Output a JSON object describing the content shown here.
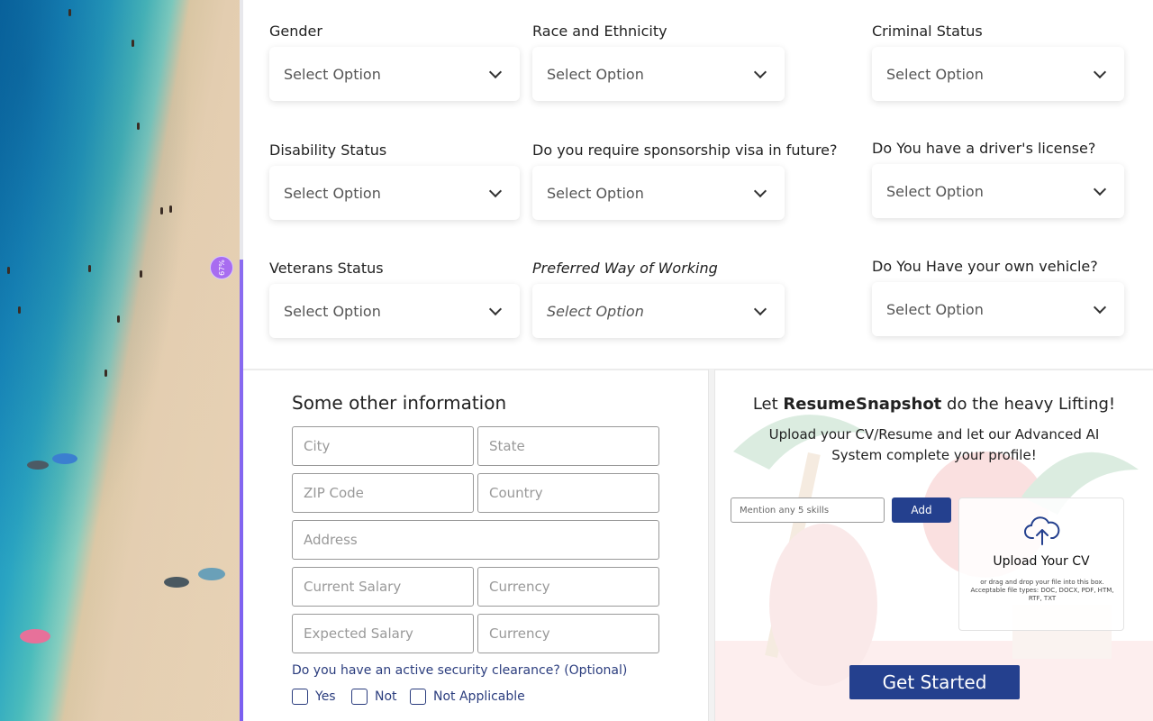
{
  "progress": {
    "percent_label": "67%",
    "value": 0.67
  },
  "select_placeholder": "Select Option",
  "fields": [
    {
      "label": "Gender",
      "value": "Select Option"
    },
    {
      "label": "Race and Ethnicity",
      "value": "Select Option"
    },
    {
      "label": "Criminal Status",
      "value": "Select Option"
    },
    {
      "label": "Disability Status",
      "value": "Select Option"
    },
    {
      "label": "Do you require sponsorship visa in future?",
      "value": "Select Option"
    },
    {
      "label": "Do You have a driver's license?",
      "value": "Select Option"
    },
    {
      "label": "Veterans Status",
      "value": "Select Option"
    },
    {
      "label": "Preferred Way of Working",
      "value": "Select Option"
    },
    {
      "label": "Do You Have your own vehicle?",
      "value": "Select Option"
    }
  ],
  "other_info": {
    "title": "Some other information",
    "placeholders": {
      "city": "City",
      "state": "State",
      "zip": "ZIP Code",
      "country": "Country",
      "address": "Address",
      "current_salary": "Current Salary",
      "current_currency": "Currency",
      "expected_salary": "Expected Salary",
      "expected_currency": "Currency"
    },
    "clearance_question": "Do you have an active security clearance? (Optional)",
    "clearance_options": [
      "Yes",
      "Not",
      "Not Applicable"
    ]
  },
  "upload": {
    "headline_prefix": "Let ",
    "brand": "ResumeSnapshot",
    "headline_suffix": " do the heavy Lifting!",
    "subline": "Upload your CV/Resume and let our Advanced AI System complete your profile!",
    "skills_placeholder": "Mention any 5 skills",
    "add_label": "Add",
    "dropzone_title": "Upload Your CV",
    "dropzone_hint": "or drag and drop your file into this box. Acceptable file types: DOC, DOCX, PDF, HTM, RTF, TXT",
    "cta_label": "Get Started"
  },
  "colors": {
    "accent": "#24408e",
    "progress": "#8b6cf0"
  }
}
